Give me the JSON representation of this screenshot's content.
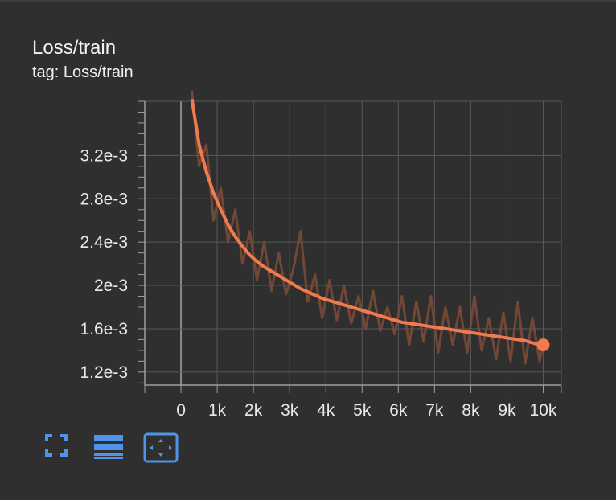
{
  "card": {
    "title": "Loss/train",
    "subtitle": "tag: Loss/train"
  },
  "colors": {
    "background": "#2f2f2f",
    "grid": "#5a5a5a",
    "axis": "#9e9e9e",
    "raw_series": "#7a4a36",
    "smoothed_series": "#f07b4e",
    "toolbar_icon": "#4f94e8"
  },
  "chart_data": {
    "type": "line",
    "title": "",
    "xlabel": "",
    "ylabel": "",
    "xlim": [
      -1000,
      10500
    ],
    "ylim": [
      0.00108,
      0.0037
    ],
    "x_tick_labels": [
      "0",
      "1k",
      "2k",
      "3k",
      "4k",
      "5k",
      "6k",
      "7k",
      "8k",
      "9k",
      "10k"
    ],
    "x_ticks": [
      0,
      1000,
      2000,
      3000,
      4000,
      5000,
      6000,
      7000,
      8000,
      9000,
      10000
    ],
    "y_tick_labels": [
      "1.2e-3",
      "1.6e-3",
      "2e-3",
      "2.4e-3",
      "2.8e-3",
      "3.2e-3"
    ],
    "y_ticks": [
      0.0012,
      0.0016,
      0.002,
      0.0024,
      0.0028,
      0.0032
    ],
    "grid": true,
    "series": [
      {
        "role": "smoothed",
        "x": [
          300,
          500,
          700,
          900,
          1100,
          1300,
          1500,
          1700,
          1900,
          2100,
          2300,
          2500,
          2700,
          2900,
          3100,
          3300,
          3500,
          3700,
          3900,
          4100,
          4300,
          4500,
          4700,
          4900,
          5100,
          5300,
          5500,
          5700,
          5900,
          6100,
          6300,
          6500,
          6700,
          6900,
          7100,
          7300,
          7500,
          7700,
          7900,
          8100,
          8300,
          8500,
          8700,
          8900,
          9100,
          9300,
          9500,
          9700,
          9900,
          10000
        ],
        "y": [
          0.00372,
          0.0033,
          0.00305,
          0.00285,
          0.0027,
          0.00256,
          0.00245,
          0.00236,
          0.00228,
          0.00222,
          0.00217,
          0.00213,
          0.00209,
          0.00205,
          0.00201,
          0.00197,
          0.00194,
          0.00191,
          0.00188,
          0.00186,
          0.00184,
          0.00182,
          0.0018,
          0.00178,
          0.00176,
          0.00174,
          0.00172,
          0.0017,
          0.00168,
          0.00166,
          0.00165,
          0.00164,
          0.00163,
          0.00162,
          0.00161,
          0.0016,
          0.00159,
          0.00158,
          0.00157,
          0.00156,
          0.00155,
          0.00154,
          0.00153,
          0.00152,
          0.00151,
          0.0015,
          0.00149,
          0.00147,
          0.00145,
          0.00145
        ]
      },
      {
        "role": "raw",
        "x": [
          300,
          500,
          700,
          900,
          1100,
          1300,
          1500,
          1700,
          1900,
          2100,
          2300,
          2500,
          2700,
          2900,
          3100,
          3300,
          3500,
          3700,
          3900,
          4100,
          4300,
          4500,
          4700,
          4900,
          5100,
          5300,
          5500,
          5700,
          5900,
          6100,
          6300,
          6500,
          6700,
          6900,
          7100,
          7300,
          7500,
          7700,
          7900,
          8100,
          8300,
          8500,
          8700,
          8900,
          9100,
          9300,
          9500,
          9700,
          9900,
          10000
        ],
        "y": [
          0.0038,
          0.0031,
          0.0033,
          0.0026,
          0.0029,
          0.0024,
          0.0027,
          0.0022,
          0.0025,
          0.00205,
          0.0024,
          0.00195,
          0.0023,
          0.00192,
          0.00215,
          0.0025,
          0.00185,
          0.0021,
          0.0017,
          0.00205,
          0.00168,
          0.002,
          0.00165,
          0.0019,
          0.0016,
          0.00195,
          0.00158,
          0.0018,
          0.00155,
          0.0019,
          0.00145,
          0.00185,
          0.00148,
          0.0019,
          0.00138,
          0.0018,
          0.00145,
          0.0018,
          0.00138,
          0.0019,
          0.0014,
          0.0017,
          0.00132,
          0.00175,
          0.0013,
          0.00185,
          0.00128,
          0.0017,
          0.0013,
          0.00145
        ]
      }
    ]
  },
  "toolbar": [
    {
      "icon": "fullscreen-icon"
    },
    {
      "icon": "legend-icon"
    },
    {
      "icon": "fit-domain-icon"
    }
  ]
}
